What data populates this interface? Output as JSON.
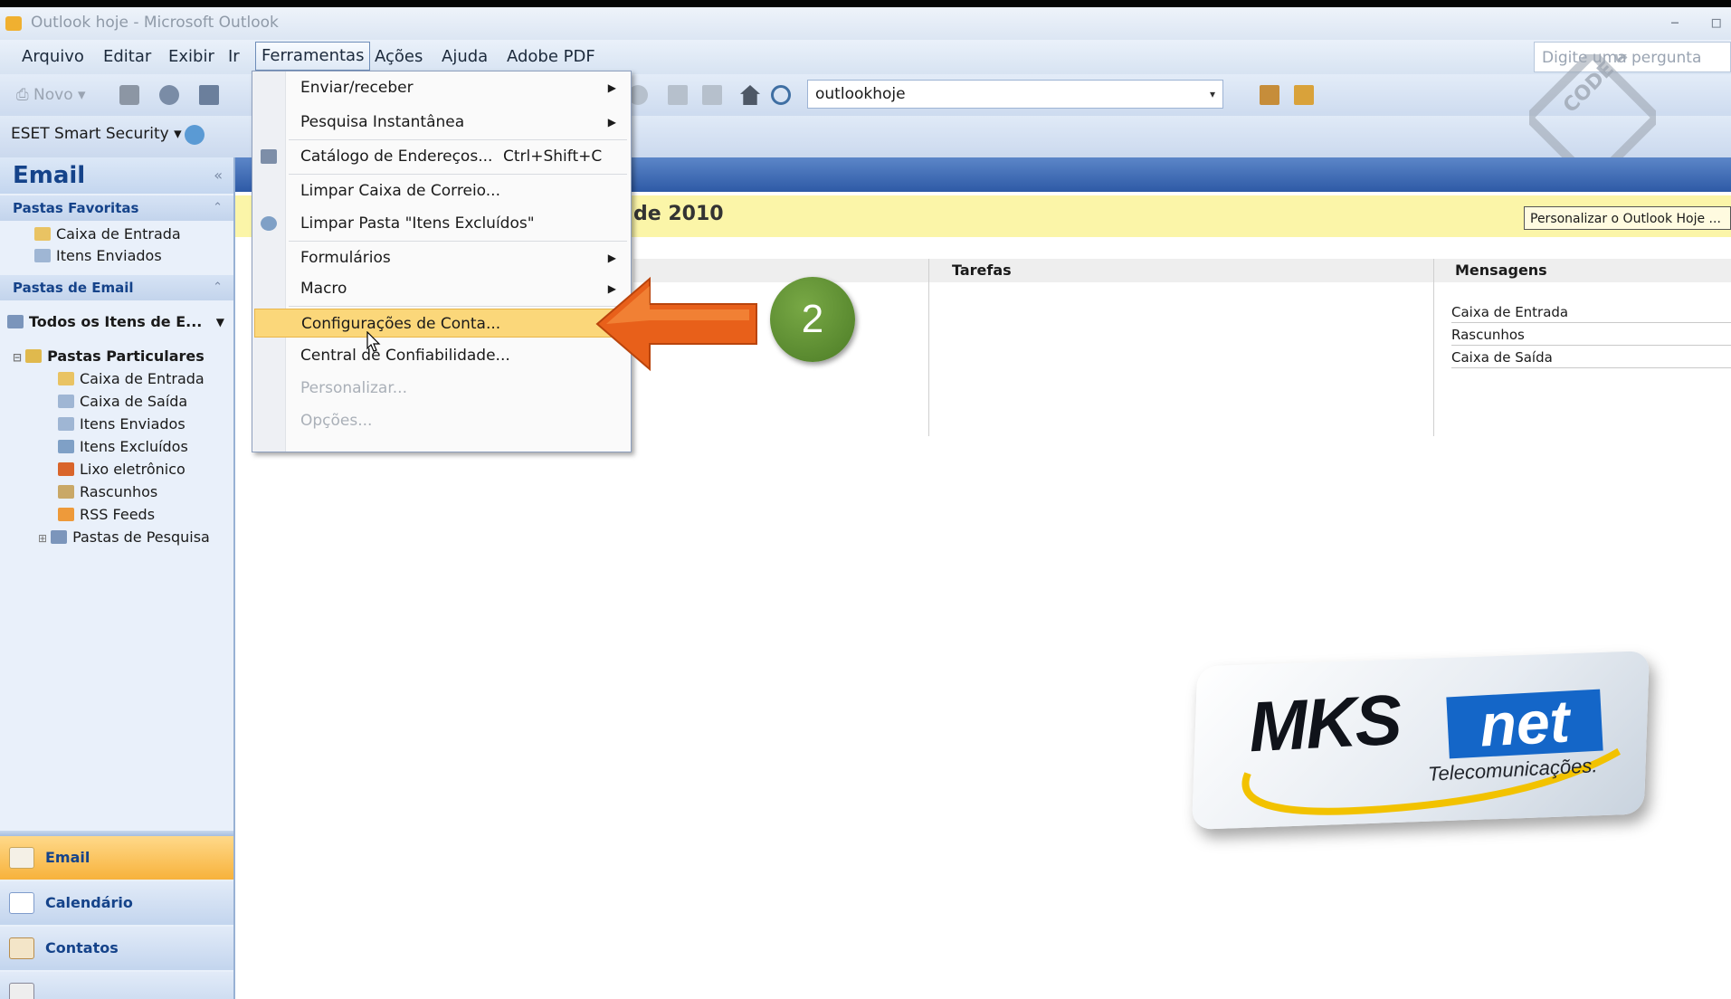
{
  "window": {
    "title": "Outlook hoje - Microsoft Outlook"
  },
  "menubar": {
    "items": [
      "Arquivo",
      "Editar",
      "Exibir",
      "Ir",
      "Ferramentas",
      "Ações",
      "Ajuda",
      "Adobe PDF"
    ],
    "ask_placeholder": "Digite uma pergunta"
  },
  "toolbar": {
    "new_label": "Novo",
    "address_value": "outlookhoje",
    "eset_label": "ESET Smart Security"
  },
  "watermark": {
    "text": "CODE 49"
  },
  "navpane": {
    "title": "Email",
    "favorites_title": "Pastas Favoritas",
    "favorites": [
      "Caixa de Entrada",
      "Itens Enviados"
    ],
    "mail_title": "Pastas de Email",
    "all_items": "Todos os Itens de E...",
    "root": "Pastas Particulares",
    "folders": [
      "Caixa de Entrada",
      "Caixa de Saída",
      "Itens Enviados",
      "Itens Excluídos",
      "Lixo eletrônico",
      "Rascunhos",
      "RSS Feeds",
      "Pastas de Pesquisa"
    ],
    "buttons": [
      "Email",
      "Calendário",
      "Contatos"
    ]
  },
  "content": {
    "date": "de 2010",
    "customize": "Personalizar o Outlook Hoje ...",
    "tasks_header": "Tarefas",
    "messages_header": "Mensagens",
    "messages": [
      "Caixa de Entrada",
      "Rascunhos",
      "Caixa de Saída"
    ]
  },
  "menu": {
    "items": [
      {
        "label": "Enviar/receber",
        "submenu": true
      },
      {
        "label": "Pesquisa Instantânea",
        "submenu": true
      },
      {
        "label": "Catálogo de Endereços...",
        "shortcut": "Ctrl+Shift+C"
      },
      {
        "label": "Limpar Caixa de Correio..."
      },
      {
        "label": "Limpar Pasta \"Itens Excluídos\""
      },
      {
        "label": "Formulários",
        "submenu": true
      },
      {
        "label": "Macro",
        "submenu": true
      },
      {
        "label": "Configurações de Conta...",
        "highlighted": true
      },
      {
        "label": "Central de Confiabilidade..."
      },
      {
        "label": "Personalizar...",
        "disabled": true
      },
      {
        "label": "Opções...",
        "disabled": true
      }
    ]
  },
  "annotation": {
    "step": "2",
    "arrow_color": "#e8601a",
    "badge_color": "#5e8f32"
  },
  "logo": {
    "brand": "MKS",
    "brand_box": "net",
    "tagline": "Telecomunicações."
  },
  "colors": {
    "highlight": "#fbd77a",
    "header_blue": "#2e5aa6",
    "date_bar": "#fbf5a8"
  }
}
